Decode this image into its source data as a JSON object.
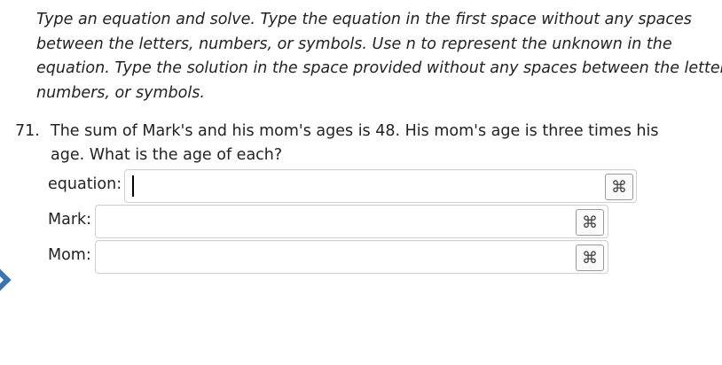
{
  "instructions": {
    "lines": [
      "Type an equation and solve.  Type the equation in the first space without any spaces",
      "between the letters, numbers, or symbols.  Use n to represent the unknown in the",
      "equation.  Type the solution in the space provided without any spaces between the letters,",
      "numbers, or symbols."
    ]
  },
  "question": {
    "number": "71.",
    "lines": [
      "The sum of Mark's and his mom's ages is 48.  His mom's age is three times his",
      "age.  What is the age of each?"
    ]
  },
  "fields": [
    {
      "label": "equation:",
      "value": "",
      "icon": "command-key-icon"
    },
    {
      "label": "Mark:",
      "value": "",
      "icon": "command-key-icon"
    },
    {
      "label": "Mom:",
      "value": "",
      "icon": "command-key-icon"
    }
  ],
  "icons": {
    "command_glyph": "⌘",
    "nav": "chevron-right-icon"
  },
  "colors": {
    "accent": "#3a73b8"
  }
}
